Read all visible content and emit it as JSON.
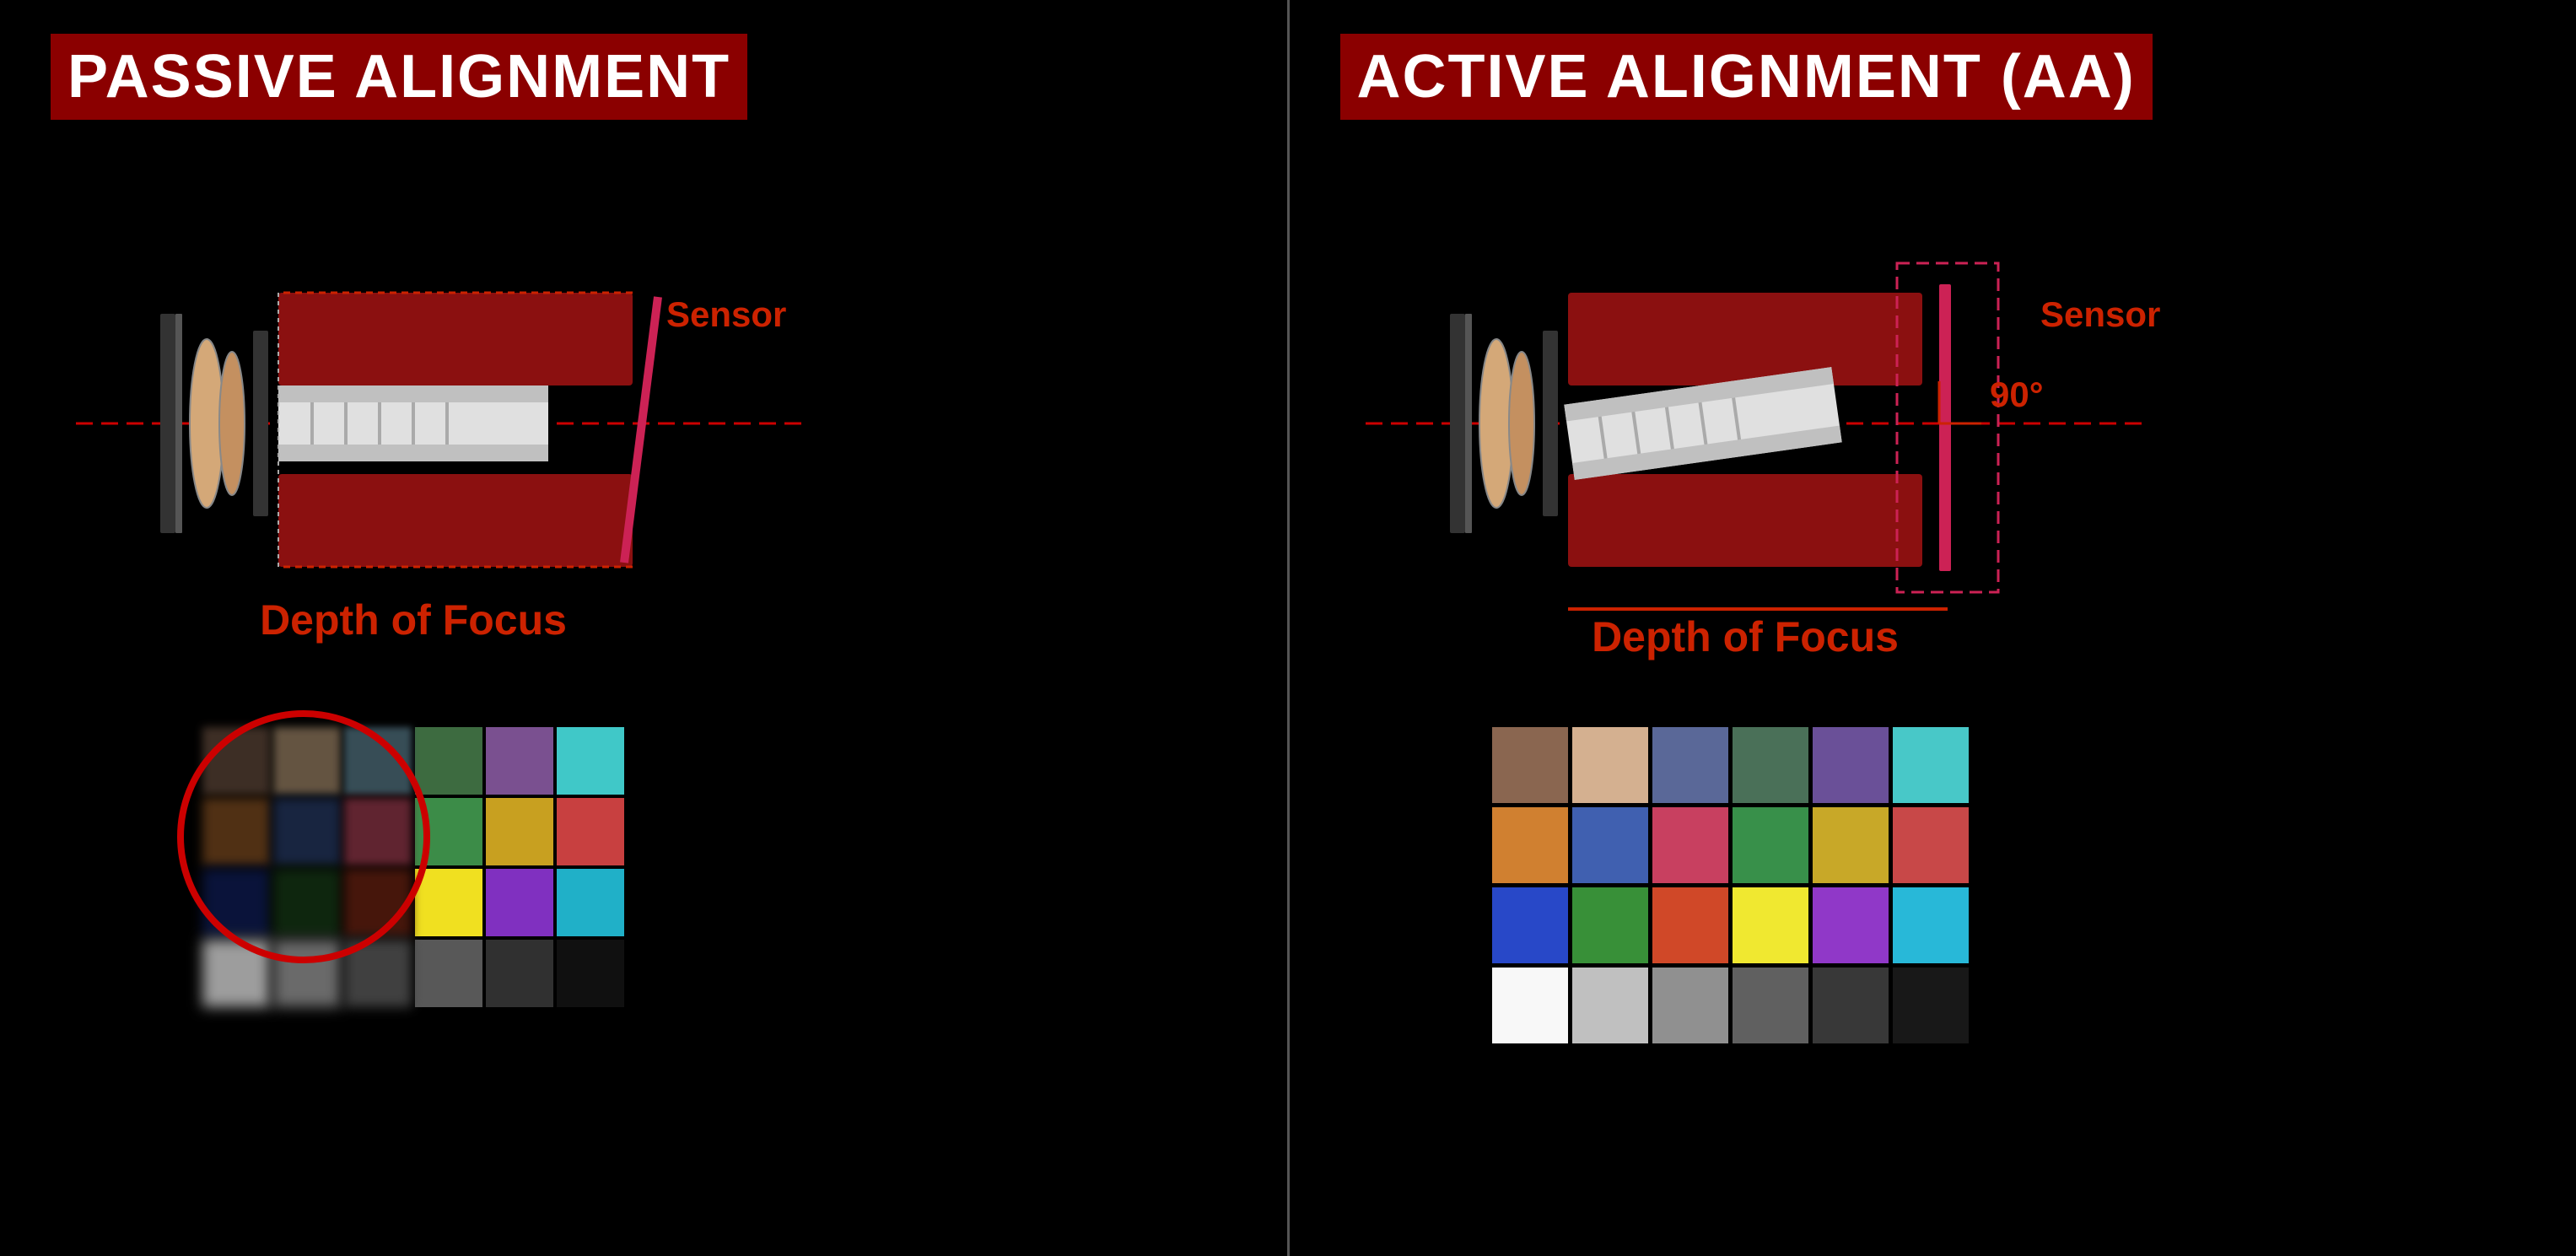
{
  "left": {
    "title": "PASSIVE ALIGNMENT",
    "depth_label": "Depth of Focus",
    "sensor_label": "Sensor",
    "colors_row1": [
      "#7a5c4a",
      "#c8a882",
      "#5b8090",
      "#3d6b40",
      "#6b4d8a",
      "#4dc8c8"
    ],
    "colors_row2": [
      "#c87832",
      "#3c5ca0",
      "#c04860",
      "#3c8c48",
      "#c8a020",
      "#c84040"
    ],
    "colors_row3": [
      "#2040c0",
      "#308030",
      "#c84020",
      "#f0e020",
      "#8030c0",
      "#20b0c8"
    ],
    "colors_row4": [
      "#f0f0f0",
      "#b0b0b0",
      "#808080",
      "#585858",
      "#303030",
      "#101010"
    ]
  },
  "right": {
    "title": "ACTIVE ALIGNMENT (AA)",
    "depth_label": "Depth of Focus",
    "sensor_label": "Sensor",
    "angle_label": "90°",
    "colors_row1": [
      "#8a6650",
      "#c8a882",
      "#5a6090",
      "#4a6a5a",
      "#6a5090",
      "#48b8c8"
    ],
    "colors_row2": [
      "#d08030",
      "#4060b0",
      "#c84060",
      "#38904a",
      "#c8a828",
      "#c84848"
    ],
    "colors_row3": [
      "#2848c8",
      "#389038",
      "#d04828",
      "#f0e830",
      "#9038c8",
      "#28b8c8"
    ],
    "colors_row4": [
      "#f8f8f8",
      "#c0c0c0",
      "#909090",
      "#606060",
      "#383838",
      "#181818"
    ]
  }
}
